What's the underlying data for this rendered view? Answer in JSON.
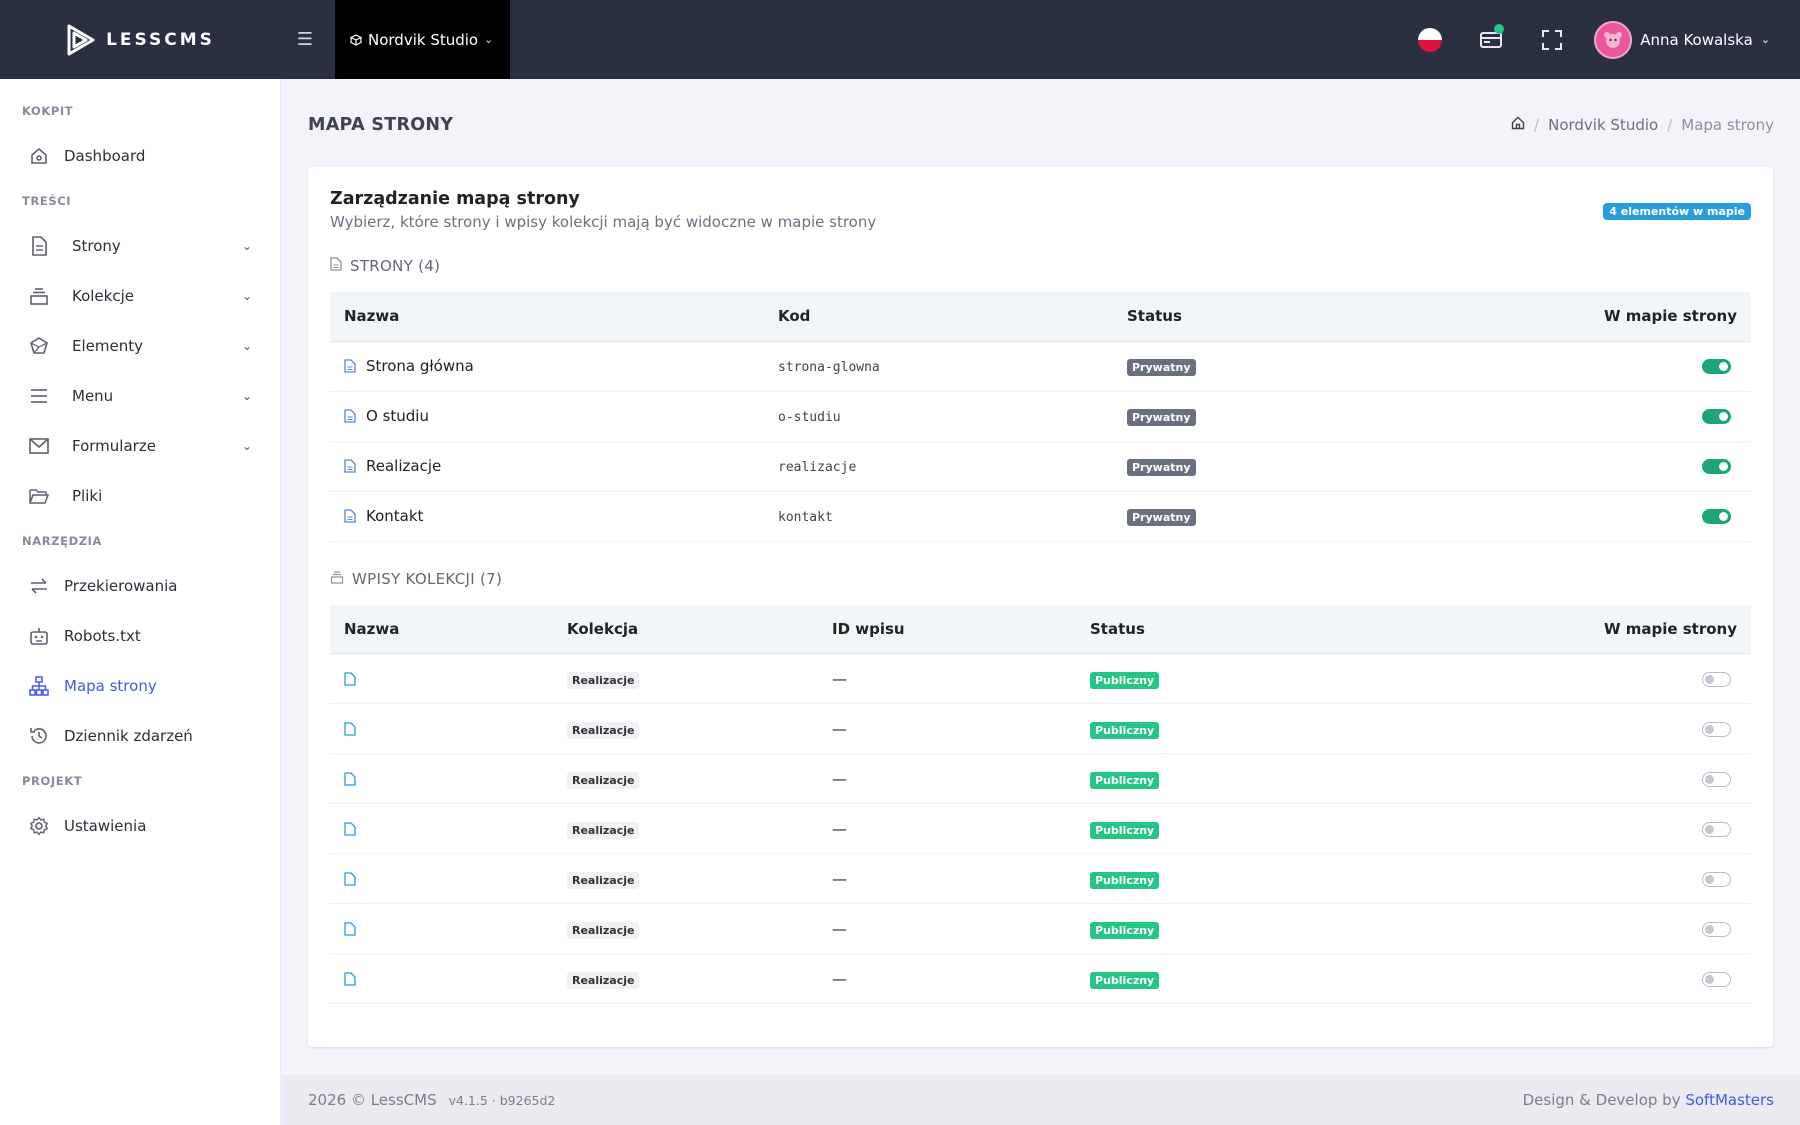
{
  "app": {
    "logo_text": "LESSCMS"
  },
  "topbar": {
    "project": "Nordvik Studio",
    "user": "Anna Kowalska",
    "icons": [
      "menu-icon",
      "flag-pl-icon",
      "card-icon",
      "fullscreen-icon",
      "avatar-icon"
    ]
  },
  "sidebar": {
    "sections": {
      "kokpit": "KOKPIT",
      "tresci": "TREŚCI",
      "narzedzia": "NARZĘDZIA",
      "projekt": "PROJEKT"
    },
    "items": {
      "dashboard": "Dashboard",
      "strony": "Strony",
      "kolekcje": "Kolekcje",
      "elementy": "Elementy",
      "menu": "Menu",
      "formularze": "Formularze",
      "pliki": "Pliki",
      "przekierowania": "Przekierowania",
      "robots": "Robots.txt",
      "mapa": "Mapa strony",
      "dziennik": "Dziennik zdarzeń",
      "ustawienia": "Ustawienia"
    },
    "active": "Mapa strony"
  },
  "page": {
    "title": "MAPA STRONY",
    "breadcrumb": [
      "Nordvik Studio",
      "Mapa strony"
    ]
  },
  "card": {
    "title": "Zarządzanie mapą strony",
    "subtitle": "Wybierz, które strony i wpisy kolekcji mają być widoczne w mapie strony",
    "pill": "4 elementów w mapie"
  },
  "pages_section": {
    "title": "STRONY (4)",
    "headers": {
      "name": "Nazwa",
      "code": "Kod",
      "status": "Status",
      "in_map": "W mapie strony"
    },
    "rows": [
      {
        "name": "Strona główna",
        "code": "strona-glowna",
        "status": "Prywatny",
        "in_map": true
      },
      {
        "name": "O studiu",
        "code": "o-studiu",
        "status": "Prywatny",
        "in_map": true
      },
      {
        "name": "Realizacje",
        "code": "realizacje",
        "status": "Prywatny",
        "in_map": true
      },
      {
        "name": "Kontakt",
        "code": "kontakt",
        "status": "Prywatny",
        "in_map": true
      }
    ]
  },
  "entries_section": {
    "title": "WPISY KOLEKCJI (7)",
    "headers": {
      "name": "Nazwa",
      "collection": "Kolekcja",
      "id": "ID wpisu",
      "status": "Status",
      "in_map": "W mapie strony"
    },
    "rows": [
      {
        "name": "",
        "collection": "Realizacje",
        "id": "—",
        "status": "Publiczny",
        "in_map": false
      },
      {
        "name": "",
        "collection": "Realizacje",
        "id": "—",
        "status": "Publiczny",
        "in_map": false
      },
      {
        "name": "",
        "collection": "Realizacje",
        "id": "—",
        "status": "Publiczny",
        "in_map": false
      },
      {
        "name": "",
        "collection": "Realizacje",
        "id": "—",
        "status": "Publiczny",
        "in_map": false
      },
      {
        "name": "",
        "collection": "Realizacje",
        "id": "—",
        "status": "Publiczny",
        "in_map": false
      },
      {
        "name": "",
        "collection": "Realizacje",
        "id": "—",
        "status": "Publiczny",
        "in_map": false
      },
      {
        "name": "",
        "collection": "Realizacje",
        "id": "—",
        "status": "Publiczny",
        "in_map": false
      }
    ]
  },
  "footer": {
    "copyright": "2026 © LessCMS",
    "version": "v4.1.5 · b9265d2",
    "credit_prefix": "Design & Develop by",
    "credit_brand": "SoftMasters"
  },
  "colors": {
    "topbar": "#2a2f42",
    "accent": "#405ae8",
    "success": "#25c586",
    "info": "#299cdb"
  }
}
